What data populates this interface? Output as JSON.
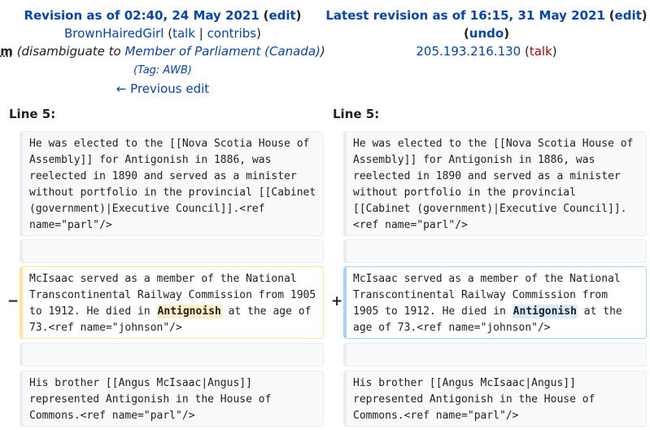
{
  "left": {
    "title": "Revision as of 02:40, 24 May 2021",
    "edit": "edit",
    "user": "BrownHairedGirl",
    "talk": "talk",
    "sep": "|",
    "contribs": "contribs",
    "minor": "m",
    "summary_prefix": "(disambiguate to ",
    "summary_link": "Member of Parliament (Canada)",
    "summary_suffix": ")",
    "tag": "(Tag: AWB)",
    "prev": "← Previous edit",
    "line": "Line 5:"
  },
  "right": {
    "title": "Latest revision as of 16:15, 31 May 2021",
    "edit": "edit",
    "undo": "undo",
    "ip": "205.193.216.130",
    "talk": "talk",
    "line": "Line 5:"
  },
  "diff": {
    "ctx1": "He was elected to the [[Nova Scotia House of Assembly]] for Antigonish in 1886, was reelected in 1890 and served as a minister without portfolio in the provincial [[Cabinet (government)|Executive Council]].<ref name=\"parl\"/>",
    "changed_before": "McIsaac served as a member of the National Transcontinental Railway Commission from 1905 to 1912. He died in ",
    "changed_after": " at the age of 73.<ref name=\"johnson\"/>",
    "old_word": "Antignoish",
    "new_word": "Antigonish",
    "minus": "−",
    "plus": "+",
    "ctx3": "His brother [[Angus McIsaac|Angus]] represented Antigonish in the House of Commons.<ref name=\"parl\"/>"
  }
}
